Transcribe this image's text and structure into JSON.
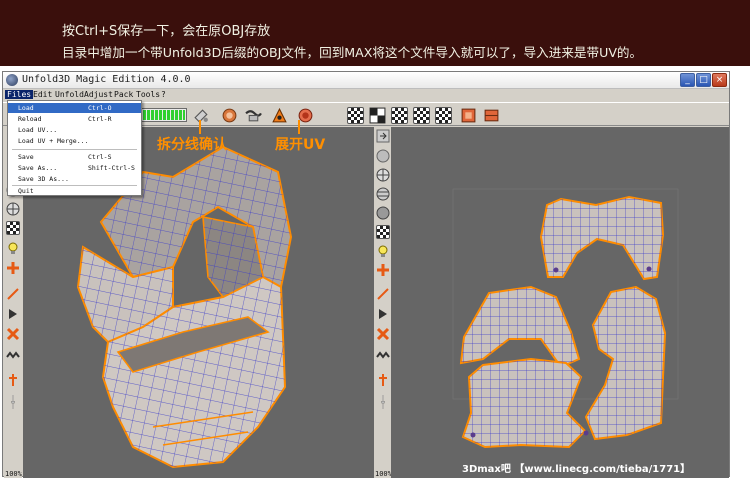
{
  "banner": {
    "line1": "按Ctrl+S保存一下，会在原OBJ存放",
    "line2": "目录中增加一个带Unfold3D后缀的OBJ文件，回到MAX将这个文件导入就可以了，导入进来是带UV的。"
  },
  "window": {
    "title": "Unfold3D Magic Edition 4.0.0",
    "minimize_glyph": "_",
    "maximize_glyph": "□",
    "close_glyph": "×"
  },
  "menubar": [
    "Files",
    "Edit",
    "Unfold",
    "Adjust",
    "Pack",
    "Tools",
    "?"
  ],
  "file_menu": {
    "items": [
      {
        "label": "Load",
        "shortcut": "Ctrl-O",
        "highlighted": true
      },
      {
        "label": "Reload",
        "shortcut": "Ctrl-R"
      },
      {
        "label": "Load UV...",
        "shortcut": ""
      },
      {
        "label": "Load UV + Merge...",
        "shortcut": ""
      },
      {
        "label": "Save",
        "shortcut": "Ctrl-S"
      },
      {
        "label": "Save As...",
        "shortcut": "Shift-Ctrl-S"
      },
      {
        "label": "Save 3D As...",
        "shortcut": ""
      },
      {
        "label": "Quit",
        "shortcut": ""
      }
    ]
  },
  "toolbar": {
    "progress": 1.0,
    "icons": [
      "cut-tool-icon",
      "unfold-icon",
      "weld-icon",
      "seam-icon",
      "optimize-icon",
      "pack-icon",
      "checker-icon",
      "checker-scale-icon",
      "checker-rotate-icon",
      "checker-color-icon",
      "material-icon"
    ]
  },
  "annotations": {
    "cut_confirm": "拆分线确认",
    "unfold_uv": "展开UV"
  },
  "sidebar": {
    "zoom_left": "100%",
    "zoom_right": "100%"
  },
  "watermark": "3Dmax吧 【www.linecg.com/tieba/1771】",
  "colors": {
    "banner_bg": "#3a0f0c",
    "viewport_bg": "#666666",
    "mesh_fill": "#c9c2bd",
    "mesh_wire": "#3b3bc9",
    "seam": "#ff8c00",
    "highlight": "#316ac5"
  }
}
